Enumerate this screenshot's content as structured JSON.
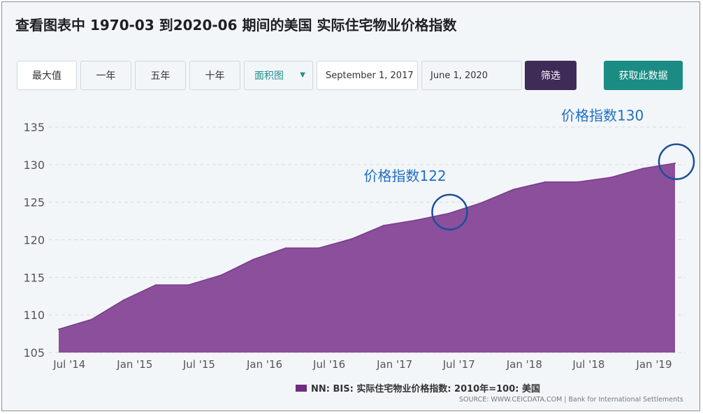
{
  "title": "查看图表中 1970-03 到2020-06 期间的美国 实际住宅物业价格指数",
  "controls": {
    "max_label": "最大值",
    "one_year_label": "一年",
    "five_year_label": "五年",
    "ten_year_label": "十年",
    "chart_type": "面积图",
    "start_date": "September 1, 2017",
    "end_date": "June 1, 2020",
    "filter_label": "筛选",
    "get_data_label": "获取此数据"
  },
  "colors": {
    "area_fill": "#8b4f9b",
    "annotation": "#1f6fc2",
    "filter_button": "#3f2b57",
    "get_data_button": "#1a8c84"
  },
  "legend": {
    "label": "NN: BIS: 实际住宅物业价格指数: 2010年=100: 美国"
  },
  "source": "SOURCE: WWW.CEICDATA.COM | Bank for International Settlements",
  "annotations": [
    {
      "label": "价格指数122",
      "x": "2017-06-01",
      "y": 123.5
    },
    {
      "label": "价格指数130",
      "x": "2019-03-01",
      "y": 130.2
    }
  ],
  "chart_data": {
    "type": "area",
    "x": [
      "2014-06-01",
      "2014-09-01",
      "2014-12-01",
      "2015-03-01",
      "2015-06-01",
      "2015-09-01",
      "2015-12-01",
      "2016-03-01",
      "2016-06-01",
      "2016-09-01",
      "2016-12-01",
      "2017-03-01",
      "2017-06-01",
      "2017-09-01",
      "2017-12-01",
      "2018-03-01",
      "2018-06-01",
      "2018-09-01",
      "2018-12-01",
      "2019-03-01"
    ],
    "series": [
      {
        "values": [
          108.1,
          109.4,
          112.0,
          114.0,
          114.0,
          115.3,
          117.4,
          118.9,
          118.9,
          120.1,
          121.9,
          122.6,
          123.5,
          124.9,
          126.7,
          127.7,
          127.7,
          128.3,
          129.5,
          130.2
        ]
      }
    ],
    "ylim": [
      105,
      135
    ],
    "yticks": [
      105,
      110,
      115,
      120,
      125,
      130,
      135
    ],
    "xticks": [
      {
        "label": "Jul '14",
        "date": "2014-07-01"
      },
      {
        "label": "Jan '15",
        "date": "2015-01-01"
      },
      {
        "label": "Jul '15",
        "date": "2015-07-01"
      },
      {
        "label": "Jan '16",
        "date": "2016-01-01"
      },
      {
        "label": "Jul '16",
        "date": "2016-07-01"
      },
      {
        "label": "Jan '17",
        "date": "2017-01-01"
      },
      {
        "label": "Jul '17",
        "date": "2017-07-01"
      },
      {
        "label": "Jan '18",
        "date": "2018-01-01"
      },
      {
        "label": "Jul '18",
        "date": "2018-07-01"
      },
      {
        "label": "Jan '19",
        "date": "2019-01-01"
      }
    ],
    "grid": true,
    "legend_position": "bottom"
  }
}
